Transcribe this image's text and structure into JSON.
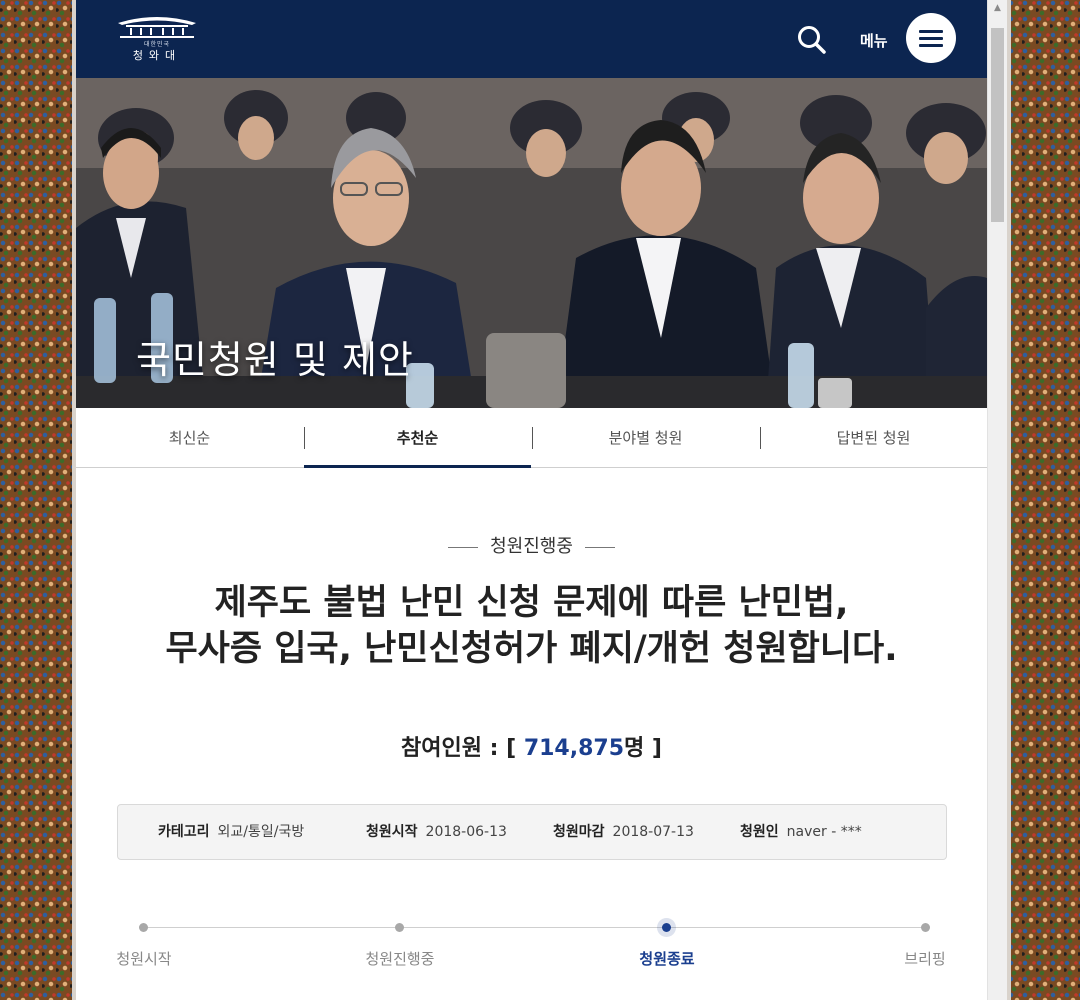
{
  "header": {
    "logo_subtitle": "대한민국",
    "logo_name": "청와대",
    "menu_label": "메뉴"
  },
  "hero": {
    "title": "국민청원 및 제안"
  },
  "tabs": [
    {
      "label": "최신순",
      "active": false
    },
    {
      "label": "추천순",
      "active": true
    },
    {
      "label": "분야별 청원",
      "active": false
    },
    {
      "label": "답변된 청원",
      "active": false
    }
  ],
  "petition": {
    "status": "청원진행중",
    "title_line1": "제주도 불법 난민 신청 문제에 따른 난민법,",
    "title_line2": "무사증 입국, 난민신청허가 폐지/개헌 청원합니다.",
    "participants_label": "참여인원 : [",
    "participants_count": "714,875",
    "participants_unit": "명 ]"
  },
  "info": {
    "category_label": "카테고리",
    "category_value": "외교/통일/국방",
    "start_label": "청원시작",
    "start_value": "2018-06-13",
    "end_label": "청원마감",
    "end_value": "2018-07-13",
    "author_label": "청원인",
    "author_value": "naver - ***"
  },
  "progress": {
    "steps": [
      {
        "label": "청원시작",
        "current": false
      },
      {
        "label": "청원진행중",
        "current": false
      },
      {
        "label": "청원종료",
        "current": true
      },
      {
        "label": "브리핑",
        "current": false
      }
    ]
  },
  "colors": {
    "header_bg": "#0c2550",
    "accent": "#1b3f8f"
  }
}
